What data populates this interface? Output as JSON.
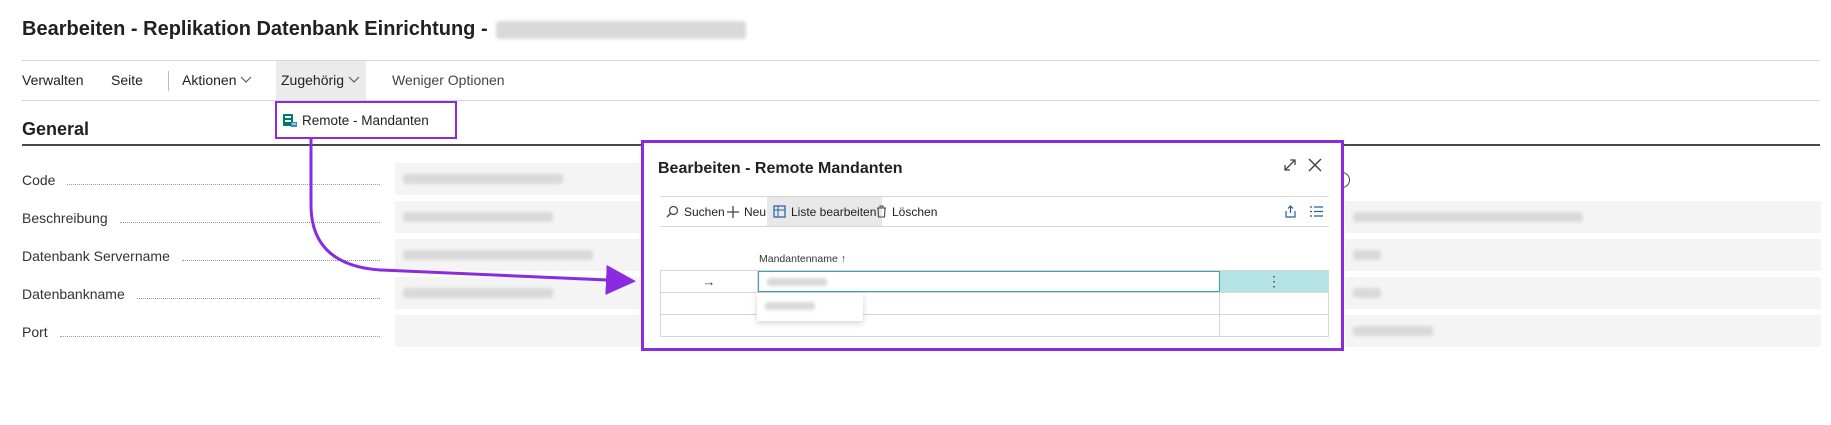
{
  "page": {
    "title": "Bearbeiten - Replikation Datenbank Einrichtung -"
  },
  "action_bar": {
    "verwalten": "Verwalten",
    "seite": "Seite",
    "aktionen": "Aktionen",
    "zugehoerig": "Zugehörig",
    "weniger_optionen": "Weniger Optionen"
  },
  "dropdown": {
    "item_label": "Remote - Mandanten",
    "icon": "remote-companies-icon"
  },
  "general": {
    "title": "General",
    "fields": [
      {
        "label": "Code"
      },
      {
        "label": "Beschreibung"
      },
      {
        "label": "Datenbank Servername"
      },
      {
        "label": "Datenbankname"
      },
      {
        "label": "Port"
      }
    ]
  },
  "modal": {
    "title": "Bearbeiten - Remote Mandanten",
    "toolbar": {
      "search": "Suchen",
      "new": "Neu",
      "edit_list": "Liste bearbeiten",
      "delete": "Löschen"
    },
    "column_header": "Mandantenname",
    "sort_indicator": "↑",
    "row_arrow": "→",
    "row_menu": "⋮",
    "expand_icon": "expand-icon",
    "close_icon": "close-icon"
  },
  "colors": {
    "highlight_border": "#8a2be2",
    "selected_cell": "#b4e3e6",
    "selected_border": "#3aa6ad",
    "accent": "#00796b"
  }
}
